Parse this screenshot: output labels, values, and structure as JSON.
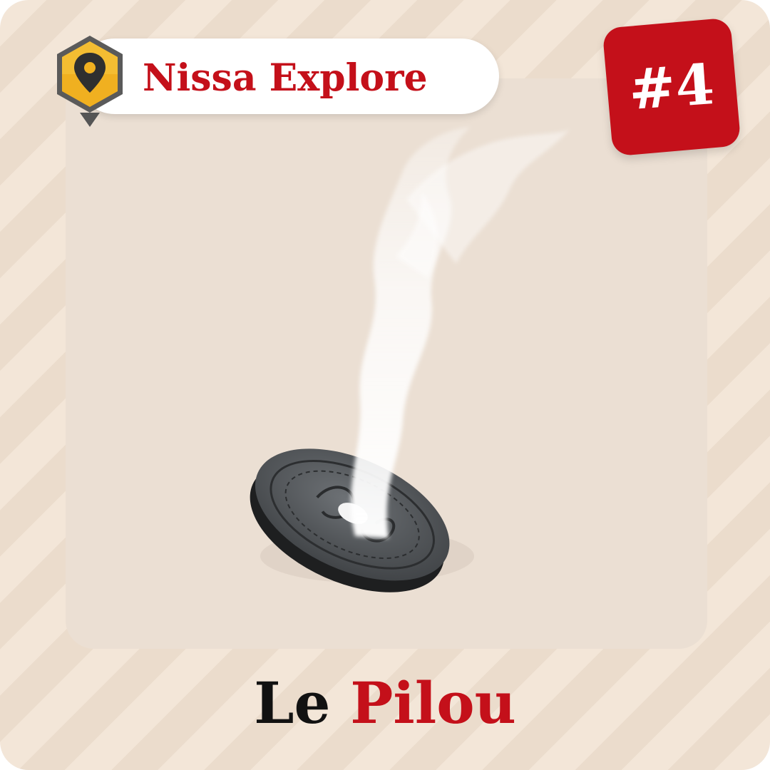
{
  "brand": {
    "name": "Nissa Explore",
    "icon": "map-pin-icon",
    "color": "#c4101a"
  },
  "rank": {
    "label": "#4",
    "color": "#c4101a"
  },
  "illustration": {
    "icon": "smoking-coin-illustration"
  },
  "title": {
    "article": "Le",
    "name": "Pilou"
  },
  "colors": {
    "background": "#f3e6d8",
    "stripe": "#ebdccc",
    "panel": "#ebdfd3",
    "accent": "#c4101a",
    "pin_badge": "#f0b020"
  }
}
